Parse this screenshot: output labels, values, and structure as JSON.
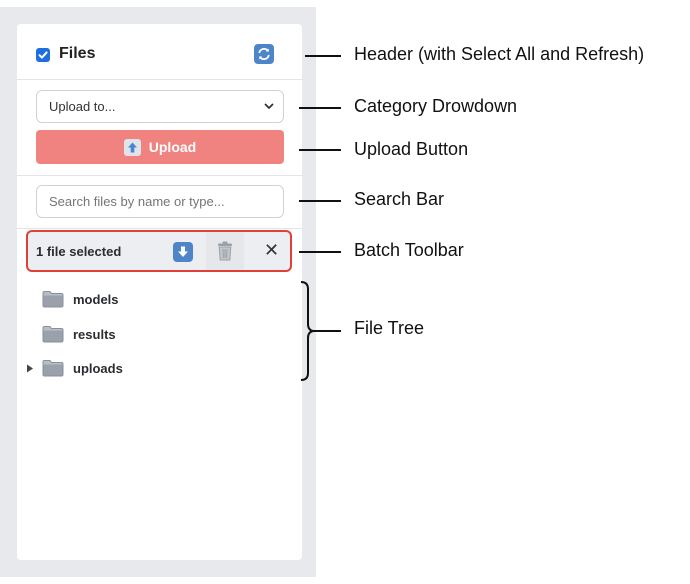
{
  "panel": {
    "header": {
      "title": "Files",
      "select_all_checked": true
    },
    "category_select": {
      "value": "Upload to..."
    },
    "upload_button": {
      "label": "Upload"
    },
    "search": {
      "placeholder": "Search files by name or type..."
    },
    "batch_toolbar": {
      "label": "1 file selected",
      "close_glyph": "✕"
    },
    "file_tree": [
      {
        "name": "models",
        "expandable": false
      },
      {
        "name": "results",
        "expandable": false
      },
      {
        "name": "uploads",
        "expandable": true
      }
    ]
  },
  "annotations": {
    "header": "Header (with Select All and Refresh)",
    "category_dropdown": "Category Drowdown",
    "upload_button": "Upload Button",
    "search_bar": "Search Bar",
    "batch_toolbar": "Batch Toolbar",
    "file_tree": "File Tree"
  },
  "icons": {
    "checkbox": "checkbox-checked-icon",
    "refresh": "refresh-icon",
    "chevron": "chevron-down-icon",
    "upload": "upload-arrow-icon",
    "download": "download-arrow-icon",
    "trash": "trash-icon",
    "close": "close-icon",
    "folder": "folder-icon",
    "caret": "caret-right-icon"
  },
  "colors": {
    "upload_button": "#f0837f",
    "toolbar_highlight": "#e0403a",
    "checkbox": "#1d6fe0",
    "icon_button": "#4e84c8",
    "sidebar_background": "#e8e9ec"
  }
}
